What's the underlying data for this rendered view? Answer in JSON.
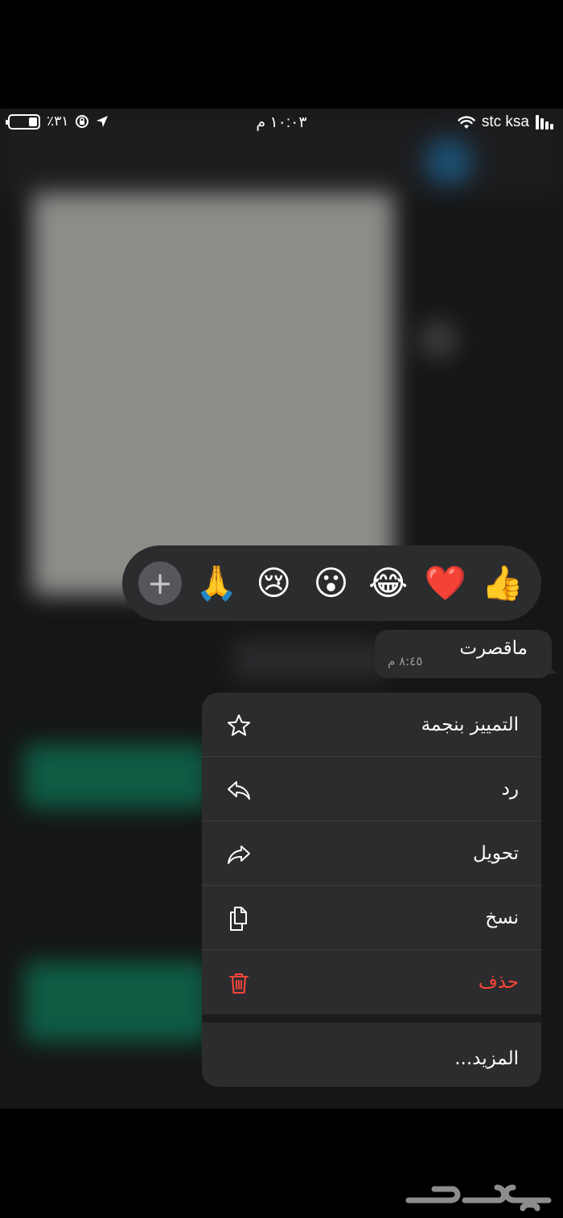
{
  "status_bar": {
    "battery_percent": "٪٣١",
    "battery_level": 0.31,
    "time": "١٠:٠٣ م",
    "carrier": "stc ksa",
    "icons": [
      "battery-icon",
      "rotation-lock-icon",
      "location-arrow-icon",
      "wifi-icon",
      "signal-bars-icon"
    ]
  },
  "reactions": {
    "add_label": "+",
    "emojis": [
      {
        "name": "folded-hands-emoji",
        "char": "🙏"
      },
      {
        "name": "crying-face-emoji",
        "char": "😢"
      },
      {
        "name": "surprised-face-emoji",
        "char": "😮"
      },
      {
        "name": "tears-of-joy-emoji",
        "char": "😂"
      },
      {
        "name": "red-heart-emoji",
        "char": "❤️"
      },
      {
        "name": "thumbs-up-emoji",
        "char": "👍"
      }
    ]
  },
  "message": {
    "text": "ماقصرت",
    "time": "٨:٤٥ م"
  },
  "menu": {
    "items": [
      {
        "label": "التمييز بنجمة",
        "icon": "star-icon"
      },
      {
        "label": "رد",
        "icon": "reply-icon"
      },
      {
        "label": "تحويل",
        "icon": "forward-icon"
      },
      {
        "label": "نسخ",
        "icon": "copy-icon"
      },
      {
        "label": "حذف",
        "icon": "trash-icon",
        "color": "#ff453a"
      }
    ],
    "more_label": "المزيد..."
  },
  "colors": {
    "danger": "#ff453a",
    "menu_bg": "#2c2c2e",
    "screen_bg": "#151617"
  }
}
